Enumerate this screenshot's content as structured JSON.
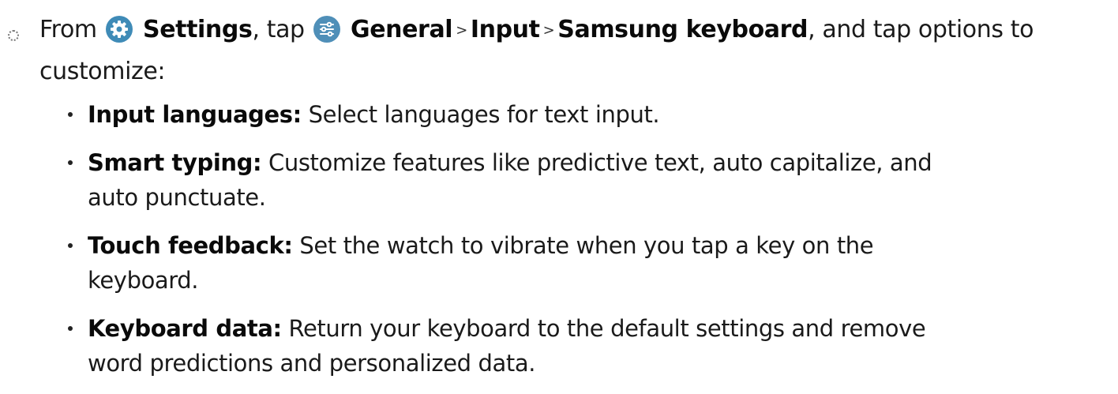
{
  "step": {
    "from": "From",
    "settings": "Settings",
    "comma_tap": ", tap",
    "general": "General",
    "sep1": ">",
    "input": "Input",
    "sep2": ">",
    "samsung_keyboard": "Samsung keyboard",
    "tail": ", and tap options to",
    "line2": "customize:"
  },
  "icons": {
    "settings": "gear-icon",
    "general": "sliders-icon",
    "settings_color": "#3f8bb7",
    "general_color": "#4f8fb8"
  },
  "items": [
    {
      "term": "Input languages:",
      "desc": " Select languages for text input."
    },
    {
      "term": "Smart typing:",
      "desc": " Customize features like predictive text, auto capitalize, and",
      "desc2": "auto punctuate."
    },
    {
      "term": "Touch feedback:",
      "desc": " Set the watch to vibrate when you tap a key on the",
      "desc2": "keyboard."
    },
    {
      "term": "Keyboard data:",
      "desc": " Return your keyboard to the default settings and remove",
      "desc2": "word predictions and personalized data."
    }
  ]
}
